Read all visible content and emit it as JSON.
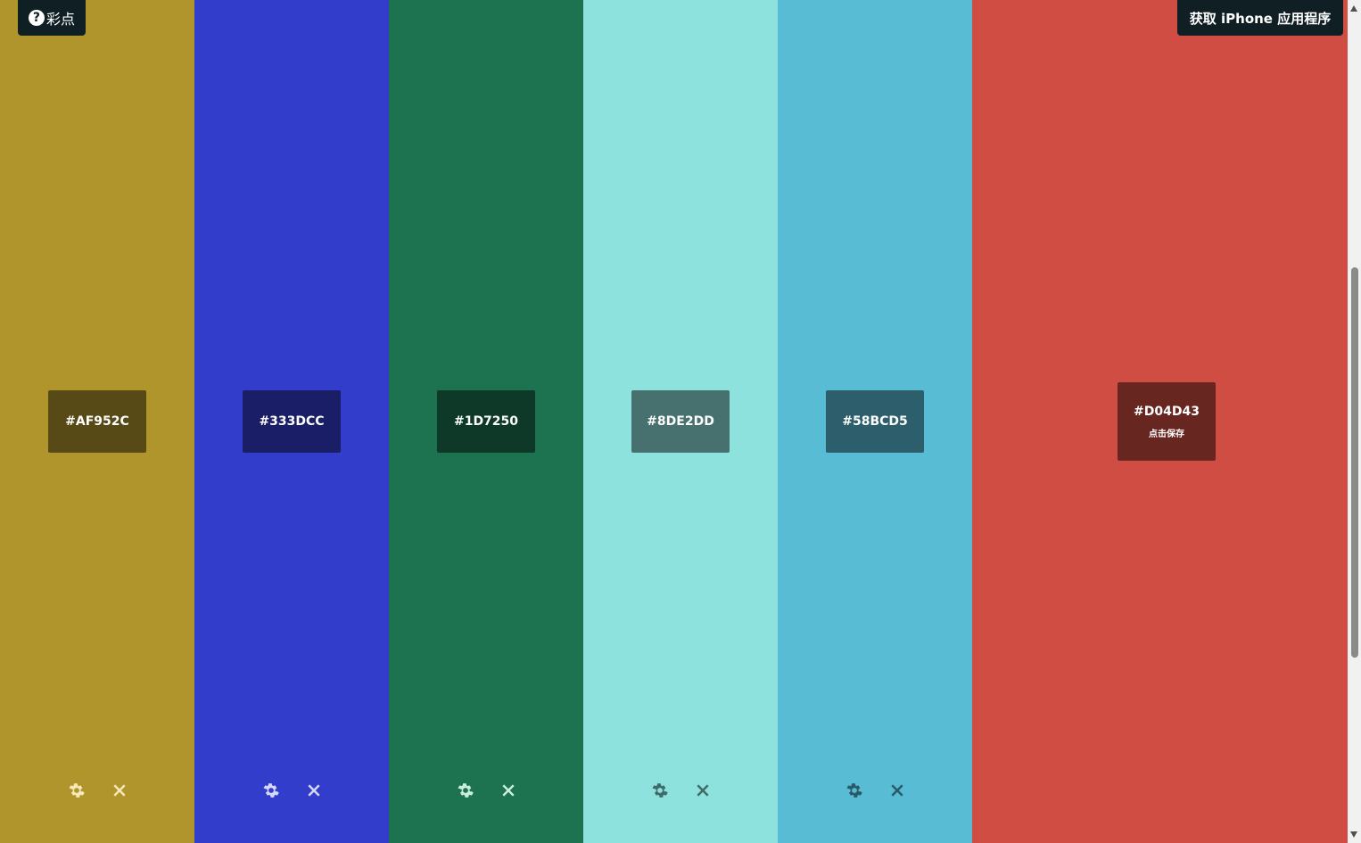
{
  "header": {
    "help_label": "彩点",
    "help_icon_glyph": "?",
    "app_button_label": "获取 iPhone 应用程序"
  },
  "colors": [
    {
      "hex": "#AF952C",
      "bg": "#AF952C",
      "label_bg": "#574A16",
      "icon_color": "#F5E9B8"
    },
    {
      "hex": "#333DCC",
      "bg": "#333DCC",
      "label_bg": "#191E66",
      "icon_color": "#D6D9FF"
    },
    {
      "hex": "#1D7250",
      "bg": "#1D7250",
      "label_bg": "#0E3928",
      "icon_color": "#C9EEDD"
    },
    {
      "hex": "#8DE2DD",
      "bg": "#8DE2DD",
      "label_bg": "#47716E",
      "icon_color": "#3F6B68"
    },
    {
      "hex": "#58BCD5",
      "bg": "#58BCD5",
      "label_bg": "#2C5E6B",
      "icon_color": "#2A5A66"
    },
    {
      "hex": "#D04D43",
      "bg": "#D04D43",
      "label_bg": "#682621",
      "icon_color": "#F6D5D2",
      "save_hint": "点击保存"
    }
  ],
  "icons": {
    "settings": "gear-icon",
    "remove": "close-icon"
  }
}
